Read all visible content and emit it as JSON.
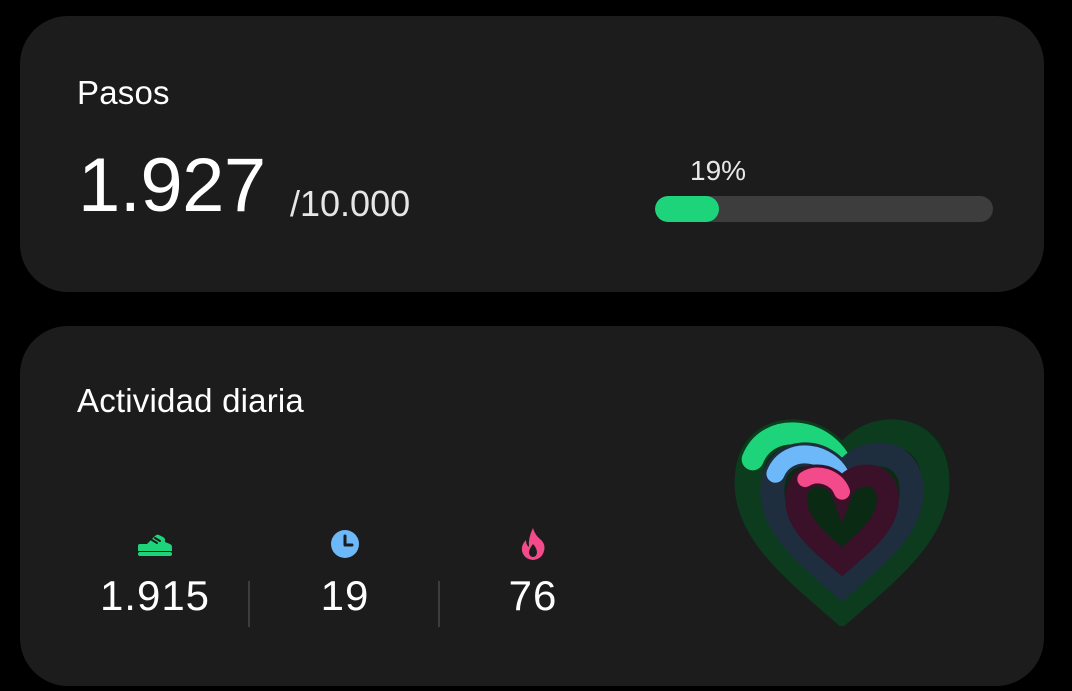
{
  "steps_card": {
    "title": "Pasos",
    "value": "1.927",
    "goal": "/10.000",
    "progress_label": "19%",
    "progress_fraction": 0.19,
    "progress_color": "#1ed47a"
  },
  "activity_card": {
    "title": "Actividad diaria",
    "stats": [
      {
        "icon": "shoe-icon",
        "value": "1.915",
        "color": "#1ed47a"
      },
      {
        "icon": "clock-icon",
        "value": "19",
        "color": "#6cb8f8"
      },
      {
        "icon": "flame-icon",
        "value": "76",
        "color": "#f24a8a"
      }
    ],
    "rings": [
      {
        "name": "steps",
        "color": "#1ed47a",
        "fraction": 0.19
      },
      {
        "name": "active-time",
        "color": "#6cb8f8",
        "fraction": 0.19
      },
      {
        "name": "calories",
        "color": "#f24a8a",
        "fraction": 0.15
      }
    ]
  }
}
